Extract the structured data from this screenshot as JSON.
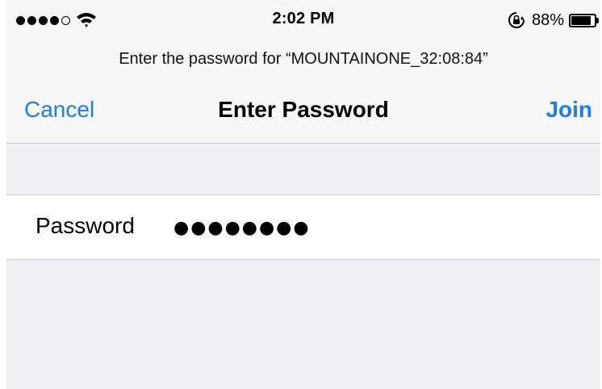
{
  "status_bar": {
    "signal_bars_filled": 4,
    "signal_bars_total": 5,
    "time": "2:02 PM",
    "battery_percent": "88%",
    "battery_level": 0.88,
    "icons": [
      "signal-dots-icon",
      "wifi-icon",
      "rotation-lock-icon",
      "battery-icon"
    ]
  },
  "prompt": "Enter the password for “MOUNTAINONE_32:08:84”",
  "nav": {
    "cancel_label": "Cancel",
    "title": "Enter Password",
    "join_label": "Join"
  },
  "form": {
    "password_label": "Password",
    "password_value": "●●●●●●●●"
  },
  "colors": {
    "accent": "#1a7fe8",
    "background": "#efeff4",
    "header_background": "#f7f7f8",
    "separator": "#c9c9ce"
  }
}
